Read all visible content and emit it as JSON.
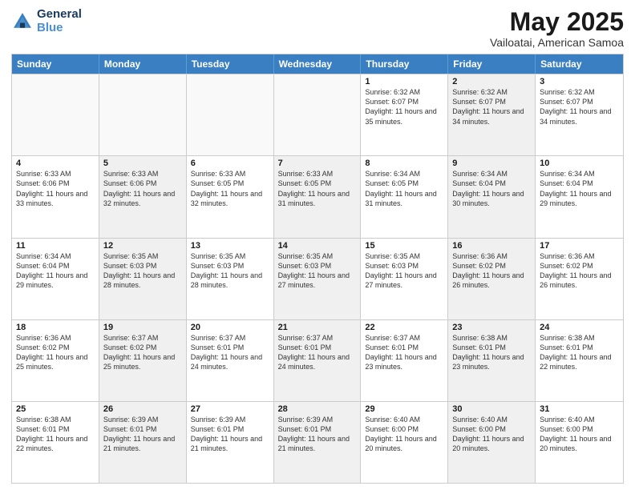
{
  "logo": {
    "line1": "General",
    "line2": "Blue"
  },
  "title": "May 2025",
  "subtitle": "Vailoatai, American Samoa",
  "days": [
    "Sunday",
    "Monday",
    "Tuesday",
    "Wednesday",
    "Thursday",
    "Friday",
    "Saturday"
  ],
  "rows": [
    [
      {
        "day": "",
        "empty": true
      },
      {
        "day": "",
        "empty": true
      },
      {
        "day": "",
        "empty": true
      },
      {
        "day": "",
        "empty": true
      },
      {
        "day": "1",
        "sunrise": "Sunrise: 6:32 AM",
        "sunset": "Sunset: 6:07 PM",
        "daylight": "Daylight: 11 hours and 35 minutes."
      },
      {
        "day": "2",
        "sunrise": "Sunrise: 6:32 AM",
        "sunset": "Sunset: 6:07 PM",
        "daylight": "Daylight: 11 hours and 34 minutes.",
        "shaded": true
      },
      {
        "day": "3",
        "sunrise": "Sunrise: 6:32 AM",
        "sunset": "Sunset: 6:07 PM",
        "daylight": "Daylight: 11 hours and 34 minutes."
      }
    ],
    [
      {
        "day": "4",
        "sunrise": "Sunrise: 6:33 AM",
        "sunset": "Sunset: 6:06 PM",
        "daylight": "Daylight: 11 hours and 33 minutes."
      },
      {
        "day": "5",
        "sunrise": "Sunrise: 6:33 AM",
        "sunset": "Sunset: 6:06 PM",
        "daylight": "Daylight: 11 hours and 32 minutes.",
        "shaded": true
      },
      {
        "day": "6",
        "sunrise": "Sunrise: 6:33 AM",
        "sunset": "Sunset: 6:05 PM",
        "daylight": "Daylight: 11 hours and 32 minutes."
      },
      {
        "day": "7",
        "sunrise": "Sunrise: 6:33 AM",
        "sunset": "Sunset: 6:05 PM",
        "daylight": "Daylight: 11 hours and 31 minutes.",
        "shaded": true
      },
      {
        "day": "8",
        "sunrise": "Sunrise: 6:34 AM",
        "sunset": "Sunset: 6:05 PM",
        "daylight": "Daylight: 11 hours and 31 minutes."
      },
      {
        "day": "9",
        "sunrise": "Sunrise: 6:34 AM",
        "sunset": "Sunset: 6:04 PM",
        "daylight": "Daylight: 11 hours and 30 minutes.",
        "shaded": true
      },
      {
        "day": "10",
        "sunrise": "Sunrise: 6:34 AM",
        "sunset": "Sunset: 6:04 PM",
        "daylight": "Daylight: 11 hours and 29 minutes."
      }
    ],
    [
      {
        "day": "11",
        "sunrise": "Sunrise: 6:34 AM",
        "sunset": "Sunset: 6:04 PM",
        "daylight": "Daylight: 11 hours and 29 minutes."
      },
      {
        "day": "12",
        "sunrise": "Sunrise: 6:35 AM",
        "sunset": "Sunset: 6:03 PM",
        "daylight": "Daylight: 11 hours and 28 minutes.",
        "shaded": true
      },
      {
        "day": "13",
        "sunrise": "Sunrise: 6:35 AM",
        "sunset": "Sunset: 6:03 PM",
        "daylight": "Daylight: 11 hours and 28 minutes."
      },
      {
        "day": "14",
        "sunrise": "Sunrise: 6:35 AM",
        "sunset": "Sunset: 6:03 PM",
        "daylight": "Daylight: 11 hours and 27 minutes.",
        "shaded": true
      },
      {
        "day": "15",
        "sunrise": "Sunrise: 6:35 AM",
        "sunset": "Sunset: 6:03 PM",
        "daylight": "Daylight: 11 hours and 27 minutes."
      },
      {
        "day": "16",
        "sunrise": "Sunrise: 6:36 AM",
        "sunset": "Sunset: 6:02 PM",
        "daylight": "Daylight: 11 hours and 26 minutes.",
        "shaded": true
      },
      {
        "day": "17",
        "sunrise": "Sunrise: 6:36 AM",
        "sunset": "Sunset: 6:02 PM",
        "daylight": "Daylight: 11 hours and 26 minutes."
      }
    ],
    [
      {
        "day": "18",
        "sunrise": "Sunrise: 6:36 AM",
        "sunset": "Sunset: 6:02 PM",
        "daylight": "Daylight: 11 hours and 25 minutes."
      },
      {
        "day": "19",
        "sunrise": "Sunrise: 6:37 AM",
        "sunset": "Sunset: 6:02 PM",
        "daylight": "Daylight: 11 hours and 25 minutes.",
        "shaded": true
      },
      {
        "day": "20",
        "sunrise": "Sunrise: 6:37 AM",
        "sunset": "Sunset: 6:01 PM",
        "daylight": "Daylight: 11 hours and 24 minutes."
      },
      {
        "day": "21",
        "sunrise": "Sunrise: 6:37 AM",
        "sunset": "Sunset: 6:01 PM",
        "daylight": "Daylight: 11 hours and 24 minutes.",
        "shaded": true
      },
      {
        "day": "22",
        "sunrise": "Sunrise: 6:37 AM",
        "sunset": "Sunset: 6:01 PM",
        "daylight": "Daylight: 11 hours and 23 minutes."
      },
      {
        "day": "23",
        "sunrise": "Sunrise: 6:38 AM",
        "sunset": "Sunset: 6:01 PM",
        "daylight": "Daylight: 11 hours and 23 minutes.",
        "shaded": true
      },
      {
        "day": "24",
        "sunrise": "Sunrise: 6:38 AM",
        "sunset": "Sunset: 6:01 PM",
        "daylight": "Daylight: 11 hours and 22 minutes."
      }
    ],
    [
      {
        "day": "25",
        "sunrise": "Sunrise: 6:38 AM",
        "sunset": "Sunset: 6:01 PM",
        "daylight": "Daylight: 11 hours and 22 minutes."
      },
      {
        "day": "26",
        "sunrise": "Sunrise: 6:39 AM",
        "sunset": "Sunset: 6:01 PM",
        "daylight": "Daylight: 11 hours and 21 minutes.",
        "shaded": true
      },
      {
        "day": "27",
        "sunrise": "Sunrise: 6:39 AM",
        "sunset": "Sunset: 6:01 PM",
        "daylight": "Daylight: 11 hours and 21 minutes."
      },
      {
        "day": "28",
        "sunrise": "Sunrise: 6:39 AM",
        "sunset": "Sunset: 6:01 PM",
        "daylight": "Daylight: 11 hours and 21 minutes.",
        "shaded": true
      },
      {
        "day": "29",
        "sunrise": "Sunrise: 6:40 AM",
        "sunset": "Sunset: 6:00 PM",
        "daylight": "Daylight: 11 hours and 20 minutes."
      },
      {
        "day": "30",
        "sunrise": "Sunrise: 6:40 AM",
        "sunset": "Sunset: 6:00 PM",
        "daylight": "Daylight: 11 hours and 20 minutes.",
        "shaded": true
      },
      {
        "day": "31",
        "sunrise": "Sunrise: 6:40 AM",
        "sunset": "Sunset: 6:00 PM",
        "daylight": "Daylight: 11 hours and 20 minutes."
      }
    ]
  ]
}
